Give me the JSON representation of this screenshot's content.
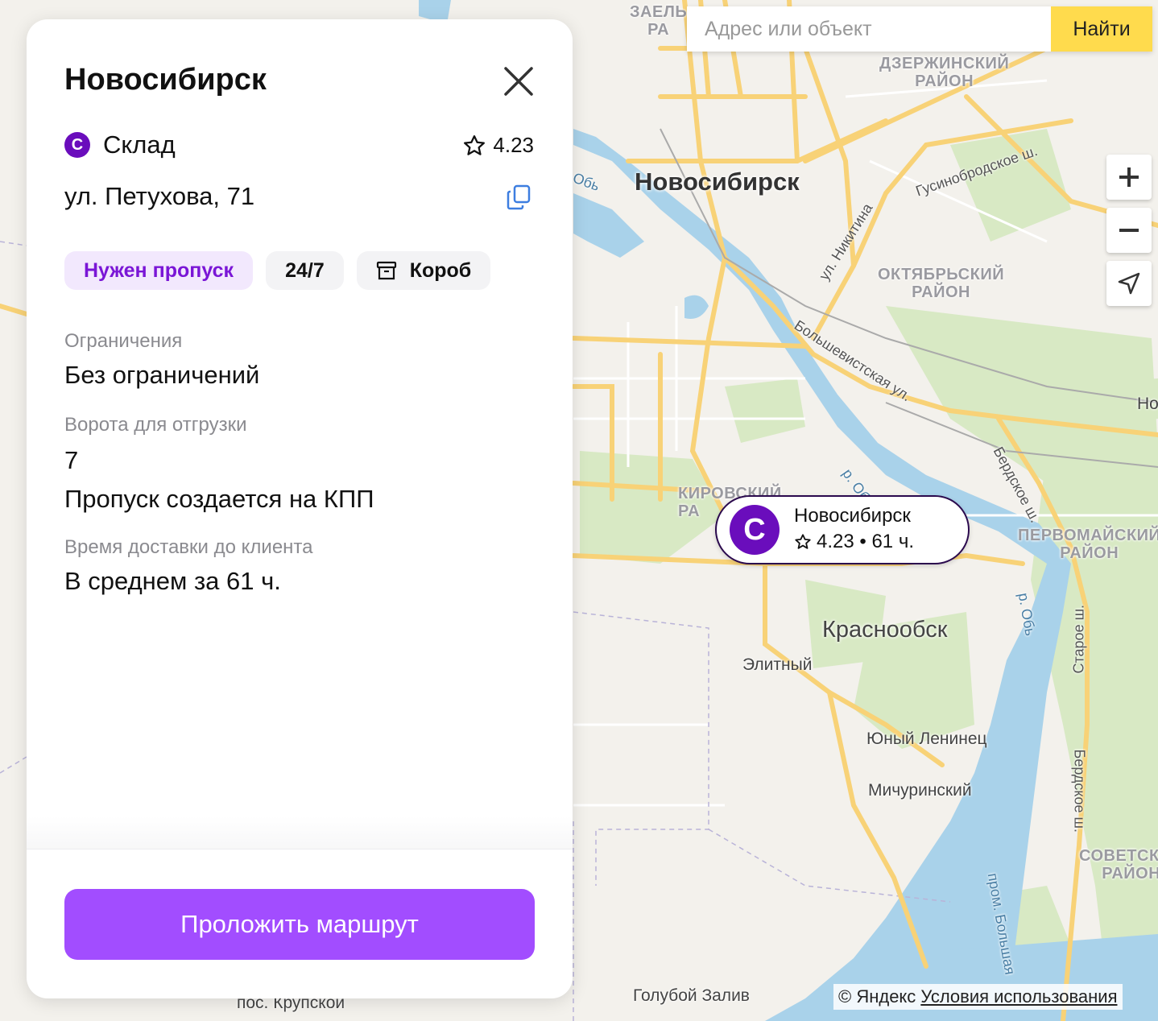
{
  "map": {
    "city_label": "Новосибирск",
    "districts": [
      {
        "id": "zaeltsovsky",
        "text": "ЗАЕЛЬ\nРА"
      },
      {
        "id": "dzerzhinsky",
        "text": "ДЗЕРЖИНСКИЙ\nРАЙОН"
      },
      {
        "id": "oktyabrsky",
        "text": "ОКТЯБРЬСКИЙ\nРАЙОН"
      },
      {
        "id": "kirovsky",
        "text": "КИРОВСКИЙ\nРА"
      },
      {
        "id": "pervomaisky",
        "text": "ПЕРВОМАЙСКИЙ\nРАЙОН"
      },
      {
        "id": "sovetsky",
        "text": "СОВЕТСКИЙ\nРАЙОН"
      }
    ],
    "towns": {
      "krasnoobsk": "Краснообск"
    },
    "places": {
      "elitny": "Элитный",
      "yuny_leninets": "Юный Ленинец",
      "michurinsky": "Мичуринский",
      "goluboy_zaliv": "Голубой Залив",
      "krupskoy": "пос. Крупской",
      "edge_no": "Но"
    },
    "streets": {
      "gusinobrodskoe": "Гусинобродское ш.",
      "nikitina": "ул. Никитина",
      "bolshevistskaya": "Большевистская ул.",
      "berdskoe1": "Бердское ш.",
      "berdskoe2": "Бердское ш.",
      "staroe": "Старое ш.",
      "river_ob1": "р. Обь",
      "river_ob2": "р. Обь",
      "prom_bolshaya": "пром. Большая",
      "ob_edge": "Обь"
    }
  },
  "search": {
    "placeholder": "Адрес или объект",
    "button_label": "Найти"
  },
  "marker": {
    "avatar_letter": "С",
    "title": "Новосибирск",
    "rating_info": "4.23 • 61 ч."
  },
  "panel": {
    "title": "Новосибирск",
    "type_letter": "С",
    "type_label": "Склад",
    "rating": "4.23",
    "address": "ул. Петухова, 71",
    "chips": {
      "pass": "Нужен пропуск",
      "hours": "24/7",
      "package": "Короб"
    },
    "restrictions_label": "Ограничения",
    "restrictions_value": "Без ограничений",
    "gates_label": "Ворота для отгрузки",
    "gates_value": "7",
    "pass_note": "Пропуск создается на КПП",
    "delivery_label": "Время доставки до клиента",
    "delivery_value": "В среднем за 61 ч.",
    "route_button": "Проложить маршрут"
  },
  "footer": {
    "copyright": "© Яндекс",
    "terms_link": "Условия использования"
  },
  "colors": {
    "accent_purple": "#6a0dbc",
    "route_button": "#a24dff",
    "search_button": "#ffdb4d",
    "road": "#f8d277",
    "water": "#a9d2ea",
    "park": "#d8e9c4"
  }
}
